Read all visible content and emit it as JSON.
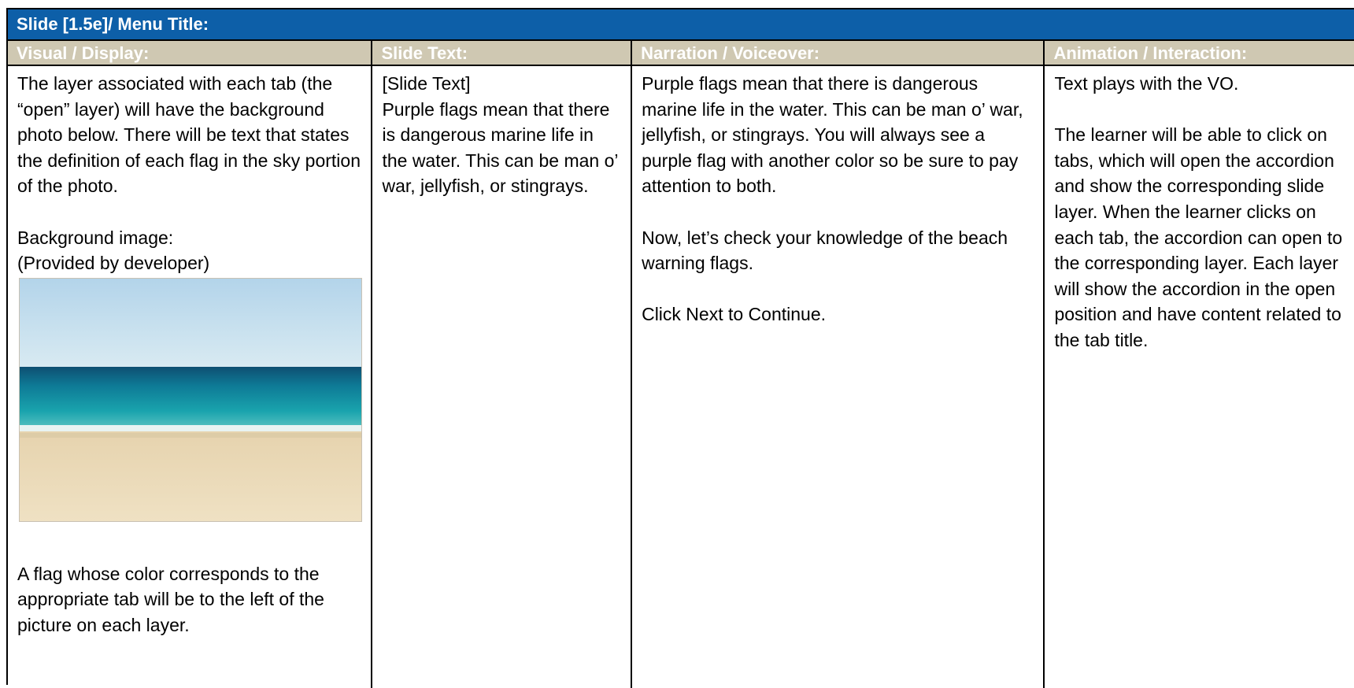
{
  "title": "Slide [1.5e]/ Menu Title:",
  "headers": {
    "visual": "Visual / Display:",
    "slide_text": "Slide Text:",
    "narration": "Narration / Voiceover:",
    "animation": "Animation / Interaction:"
  },
  "visual": {
    "intro": "The layer associated with each tab (the “open” layer) will have the background photo below. There will be text that states the definition of each flag in the sky portion of the photo.",
    "bg_label": "Background image:",
    "bg_note": "(Provided by developer)",
    "image_alt": "beach photo with ocean and sand",
    "flag_note": "A flag whose color corresponds to the appropriate tab will be to the left of the picture on each layer."
  },
  "slide_text": {
    "label": "[Slide Text]",
    "body": "Purple flags mean that there is dangerous marine life in the water. This can be man o’ war, jellyfish, or stingrays."
  },
  "narration": {
    "p1": "Purple flags mean that there is dangerous marine life in the water. This can be man o’ war, jellyfish, or stingrays. You will always see a purple flag with another color so be sure to pay attention to both.",
    "p2": "Now, let’s check your knowledge of the beach warning flags.",
    "p3": "Click Next to Continue."
  },
  "animation": {
    "p1": "Text plays with the VO.",
    "p2": "The learner will be able to click on tabs, which will open the accordion and show the corresponding slide layer. When the learner clicks on each tab, the accordion can open to the corresponding layer. Each layer will show the accordion in the open position and have content related to the tab title."
  },
  "colors": {
    "title_bar": "#0d5fa8",
    "header_bar": "#cfc8b2"
  }
}
